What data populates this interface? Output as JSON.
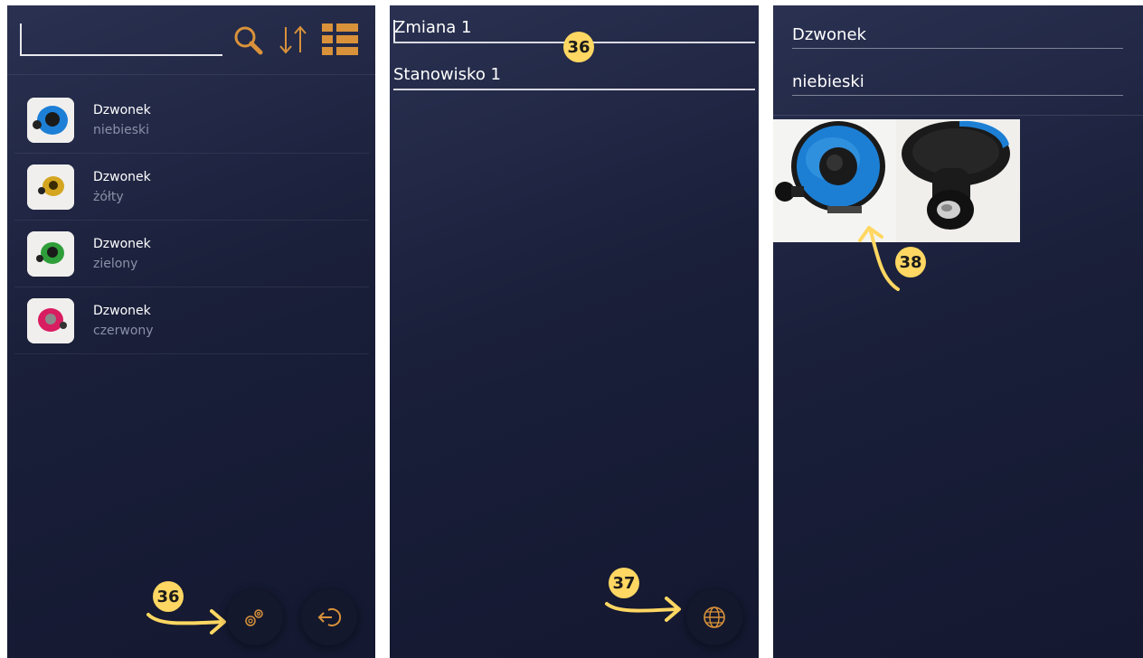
{
  "list_screen": {
    "search": {
      "value": "",
      "placeholder": ""
    },
    "icons": {
      "search": "search-icon",
      "sort": "sort-icon",
      "view": "list-view-icon"
    },
    "items": [
      {
        "title": "Dzwonek",
        "subtitle": "niebieski",
        "color": "#1d7fd6"
      },
      {
        "title": "Dzwonek",
        "subtitle": "żółty",
        "color": "#d4a520"
      },
      {
        "title": "Dzwonek",
        "subtitle": "zielony",
        "color": "#2f9e3a"
      },
      {
        "title": "Dzwonek",
        "subtitle": "czerwony",
        "color": "#d81d61"
      }
    ],
    "fabs": {
      "settings": "gears-icon",
      "logout": "logout-icon"
    },
    "annotation": "36"
  },
  "shift_screen": {
    "fields": [
      {
        "value": "Zmiana 1"
      },
      {
        "value": "Stanowisko 1"
      }
    ],
    "annotation_field": "36",
    "annotation_fab": "37",
    "fab_icon": "globe-chat-icon"
  },
  "detail_screen": {
    "fields": [
      {
        "value": "Dzwonek"
      },
      {
        "value": "niebieski"
      }
    ],
    "annotation": "38"
  },
  "colors": {
    "accent": "#d9923a",
    "annotation": "#ffd762",
    "background": "#1c213c",
    "muted_text": "#8b90a8"
  }
}
